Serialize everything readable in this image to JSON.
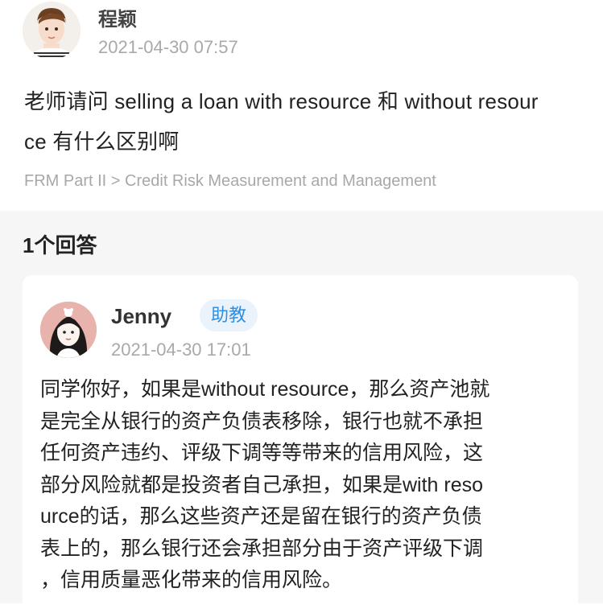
{
  "question": {
    "author_name": "程颖",
    "timestamp": "2021-04-30 07:57",
    "text_line1": "老师请问 selling a loan with resource 和 without resour",
    "text_line2": "ce 有什么区别啊",
    "tag": "FRM Part II > Credit Risk Measurement and Management"
  },
  "answers_header": {
    "count_label": "1个回答"
  },
  "answer": {
    "author_name": "Jenny",
    "badge": "助教",
    "timestamp": "2021-04-30 17:01",
    "lines": [
      "同学你好，如果是without resource，那么资产池就",
      "是完全从银行的资产负债表移除，银行也就不承担",
      "任何资产违约、评级下调等等带来的信用风险，这",
      "部分风险就都是投资者自己承担，如果是with reso",
      "urce的话，那么这些资产还是留在银行的资产负债",
      "表上的，那么银行还会承担部分由于资产评级下调",
      "，信用质量恶化带来的信用风险。"
    ]
  }
}
